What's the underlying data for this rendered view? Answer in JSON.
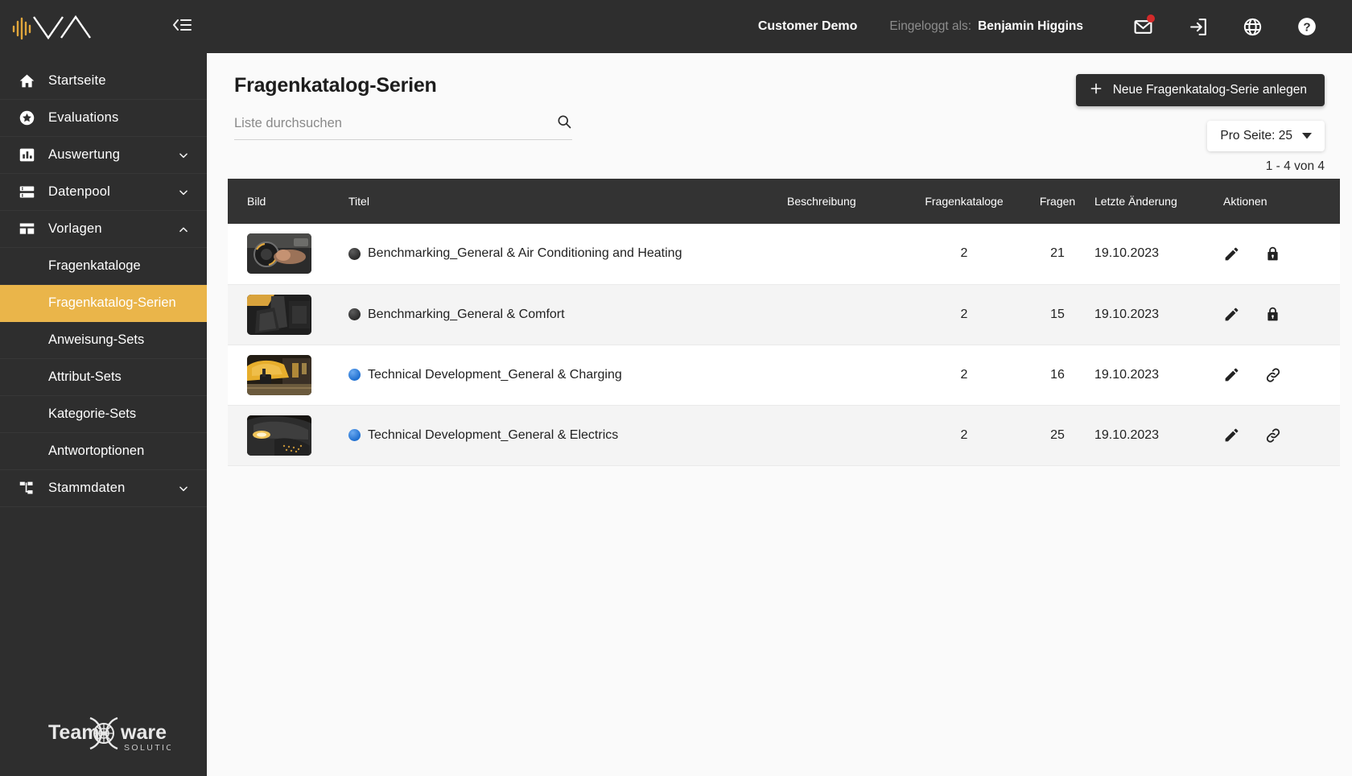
{
  "sidebar": {
    "logo_alt": "app-logo",
    "collapse_icon": "collapse-sidebar-icon",
    "items": [
      {
        "label": "Startseite",
        "icon": "home-icon",
        "expandable": false
      },
      {
        "label": "Evaluations",
        "icon": "star-icon",
        "expandable": false
      },
      {
        "label": "Auswertung",
        "icon": "bar-chart-icon",
        "expandable": true,
        "expanded": false
      },
      {
        "label": "Datenpool",
        "icon": "database-icon",
        "expandable": true,
        "expanded": false
      },
      {
        "label": "Vorlagen",
        "icon": "layout-icon",
        "expandable": true,
        "expanded": true
      },
      {
        "label": "Stammdaten",
        "icon": "hierarchy-icon",
        "expandable": true,
        "expanded": false
      }
    ],
    "vorlagen_subitems": [
      {
        "label": "Fragenkataloge",
        "active": false
      },
      {
        "label": "Fragenkatalog-Serien",
        "active": true
      },
      {
        "label": "Anweisung-Sets",
        "active": false
      },
      {
        "label": "Attribut-Sets",
        "active": false
      },
      {
        "label": "Kategorie-Sets",
        "active": false
      },
      {
        "label": "Antwortoptionen",
        "active": false
      }
    ],
    "footer_logo": {
      "text_left": "Team",
      "text_right": "ware",
      "subtext": "SOLUTIONS"
    },
    "active_accent_color": "#eab54a",
    "background_color": "#2e2e2e"
  },
  "topbar": {
    "tenant": "Customer Demo",
    "logged_in_label": "Eingeloggt als:",
    "user_name": "Benjamin Higgins",
    "icons": [
      {
        "name": "mail-icon",
        "has_badge": true
      },
      {
        "name": "logout-icon",
        "has_badge": false
      },
      {
        "name": "globe-icon",
        "has_badge": false
      },
      {
        "name": "help-icon",
        "has_badge": false
      }
    ],
    "badge_color": "#d32a2a"
  },
  "page": {
    "title": "Fragenkatalog-Serien",
    "search_placeholder": "Liste durchsuchen",
    "search_value": "",
    "search_icon": "search-icon",
    "new_button_label": "Neue Fragenkatalog-Serie anlegen",
    "new_button_icon": "plus-icon",
    "per_page_label": "Pro Seite: 25",
    "per_page_icon": "chevron-down-icon",
    "result_count": "1 - 4 von 4"
  },
  "table": {
    "columns": [
      "Bild",
      "Titel",
      "Beschreibung",
      "Fragenkataloge",
      "Fragen",
      "Letzte Änderung",
      "Aktionen"
    ],
    "rows": [
      {
        "thumb": "steering-wheel-controls",
        "marker": "dark",
        "title": "Benchmarking_General & Air Conditioning and Heating",
        "beschreibung": "",
        "fragenkataloge": "2",
        "fragen": "21",
        "letzte_aenderung": "19.10.2023",
        "actions": [
          "edit-icon",
          "lock-icon"
        ]
      },
      {
        "thumb": "car-seat-interior",
        "marker": "dark",
        "title": "Benchmarking_General & Comfort",
        "beschreibung": "",
        "fragenkataloge": "2",
        "fragen": "15",
        "letzte_aenderung": "19.10.2023",
        "actions": [
          "edit-icon",
          "lock-icon"
        ]
      },
      {
        "thumb": "yellow-car-charging",
        "marker": "blue",
        "title": "Technical Development_General & Charging",
        "beschreibung": "",
        "fragenkataloge": "2",
        "fragen": "16",
        "letzte_aenderung": "19.10.2023",
        "actions": [
          "edit-icon",
          "link-icon"
        ]
      },
      {
        "thumb": "car-front-headlight",
        "marker": "blue",
        "title": "Technical Development_General & Electrics",
        "beschreibung": "",
        "fragenkataloge": "2",
        "fragen": "25",
        "letzte_aenderung": "19.10.2023",
        "actions": [
          "edit-icon",
          "link-icon"
        ]
      }
    ]
  }
}
